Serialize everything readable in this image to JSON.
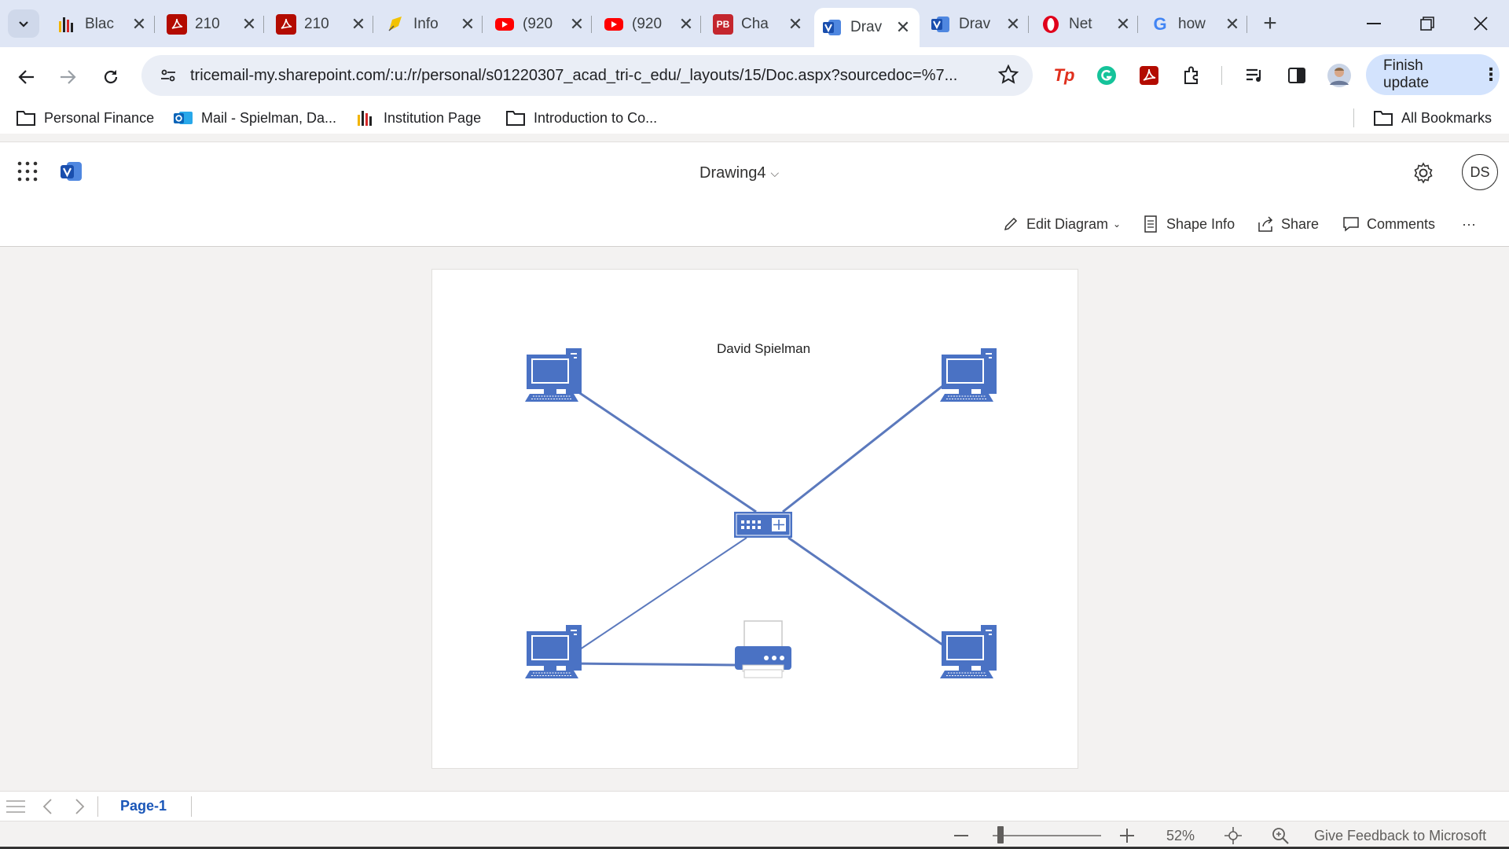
{
  "browser": {
    "tabs": [
      {
        "title": "Blac",
        "icon": "bar-chart-icon",
        "color": "#222222"
      },
      {
        "title": "210",
        "icon": "pdf-icon",
        "color": "#b30b00"
      },
      {
        "title": "210",
        "icon": "pdf-icon",
        "color": "#b30b00"
      },
      {
        "title": "Info",
        "icon": "pencil-note-icon",
        "color": "#f2c200"
      },
      {
        "title": "(920",
        "icon": "youtube-icon",
        "color": "#ff0000"
      },
      {
        "title": "(920",
        "icon": "youtube-icon",
        "color": "#ff0000"
      },
      {
        "title": "Cha",
        "icon": "pb-icon",
        "color": "#c4262e"
      },
      {
        "title": "Drav",
        "icon": "visio-icon",
        "color": "#2b5cb6",
        "active": true
      },
      {
        "title": "Drav",
        "icon": "visio-icon",
        "color": "#2b5cb6"
      },
      {
        "title": "Net",
        "icon": "opera-icon",
        "color": "#e0001b"
      },
      {
        "title": "how",
        "icon": "google-icon",
        "color": "#4285f4"
      }
    ],
    "url": "tricemail-my.sharepoint.com/:u:/r/personal/s01220307_acad_tri-c_edu/_layouts/15/Doc.aspx?sourcedoc=%7...",
    "finish_update": "Finish update",
    "bookmarks": {
      "personal_finance": "Personal Finance",
      "mail": "Mail - Spielman, Da...",
      "institution": "Institution Page",
      "intro": "Introduction to Co...",
      "all": "All Bookmarks"
    }
  },
  "visio": {
    "doc_name": "Drawing4",
    "avatar_initials": "DS",
    "commands": {
      "edit_diagram": "Edit Diagram",
      "shape_info": "Shape Info",
      "share": "Share",
      "comments": "Comments",
      "more": "···"
    },
    "diagram": {
      "title": "David Spielman",
      "shapes": [
        "computer",
        "computer",
        "switch",
        "computer",
        "printer",
        "computer"
      ],
      "accent": "#4a72c4",
      "line_color": "#5b79bd"
    },
    "page_tab": "Page-1",
    "zoom_label": "52%",
    "feedback": "Give Feedback to Microsoft"
  }
}
